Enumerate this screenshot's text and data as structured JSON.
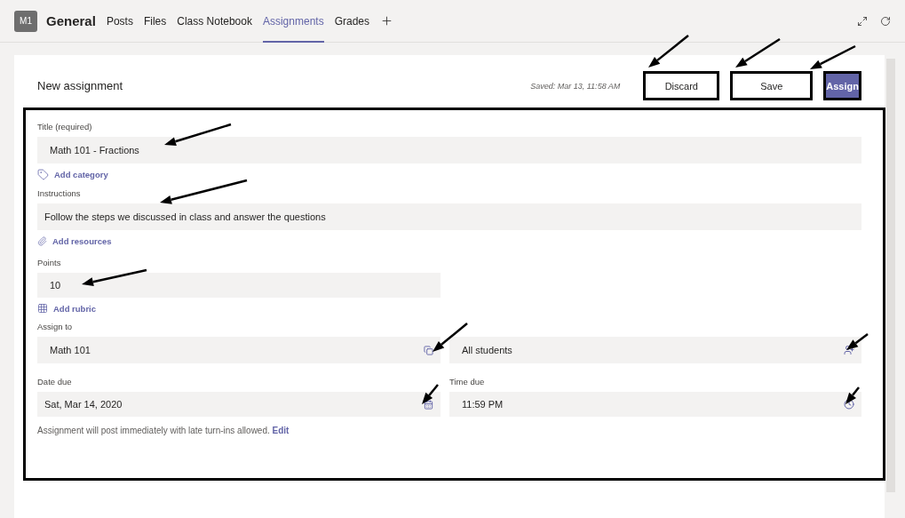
{
  "channel": {
    "avatar": "M1",
    "name": "General"
  },
  "tabs": [
    {
      "label": "Posts",
      "selected": false
    },
    {
      "label": "Files",
      "selected": false
    },
    {
      "label": "Class Notebook",
      "selected": false
    },
    {
      "label": "Assignments",
      "selected": true
    },
    {
      "label": "Grades",
      "selected": false
    }
  ],
  "assignment": {
    "heading": "New assignment",
    "saved": "Saved: Mar 13, 11:58 AM",
    "buttons": [
      {
        "label": "Discard",
        "kind": "secondary"
      },
      {
        "label": "Save",
        "kind": "secondary"
      },
      {
        "label": "Assign",
        "kind": "primary"
      }
    ],
    "title": {
      "label": "Title (required)",
      "value": "Math 101 - Fractions"
    },
    "add_category": "Add category",
    "instructions": {
      "label": "Instructions",
      "value": "Follow the steps we discussed in class and answer the questions"
    },
    "add_resources": "Add resources",
    "points": {
      "label": "Points",
      "value": "10"
    },
    "add_rubric": "Add rubric",
    "assign_to": {
      "label": "Assign to",
      "class": "Math 101",
      "students": "All students"
    },
    "date_due": {
      "label": "Date due",
      "value": "Sat, Mar 14, 2020"
    },
    "time_due": {
      "label": "Time due",
      "value": "11:59 PM"
    },
    "note": "Assignment will post immediately with late turn-ins allowed.",
    "note_link": "Edit"
  }
}
